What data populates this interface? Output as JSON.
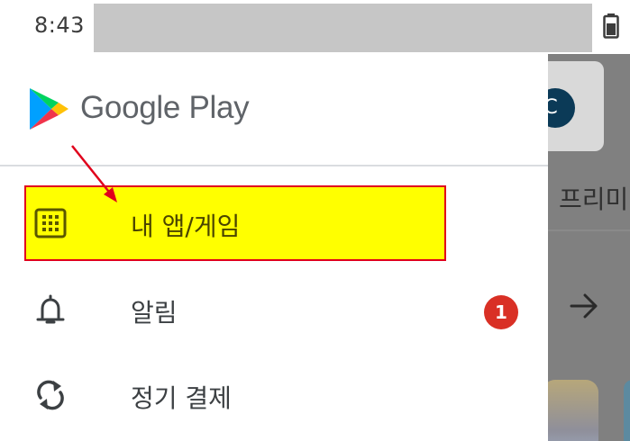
{
  "status_bar": {
    "time": "8:43"
  },
  "drawer": {
    "brand": "Google Play",
    "items": [
      {
        "label": "내 앱/게임",
        "icon": "apps-grid-icon",
        "highlighted": true
      },
      {
        "label": "알림",
        "icon": "bell-icon",
        "badge": "1"
      },
      {
        "label": "정기 결제",
        "icon": "sync-icon"
      }
    ]
  },
  "background_app": {
    "avatar_letter": "C",
    "premium_text": "프리미"
  },
  "colors": {
    "highlight": "#ffff00",
    "highlight_border": "#e0001b",
    "badge": "#d93025",
    "scrim": "#808080"
  }
}
